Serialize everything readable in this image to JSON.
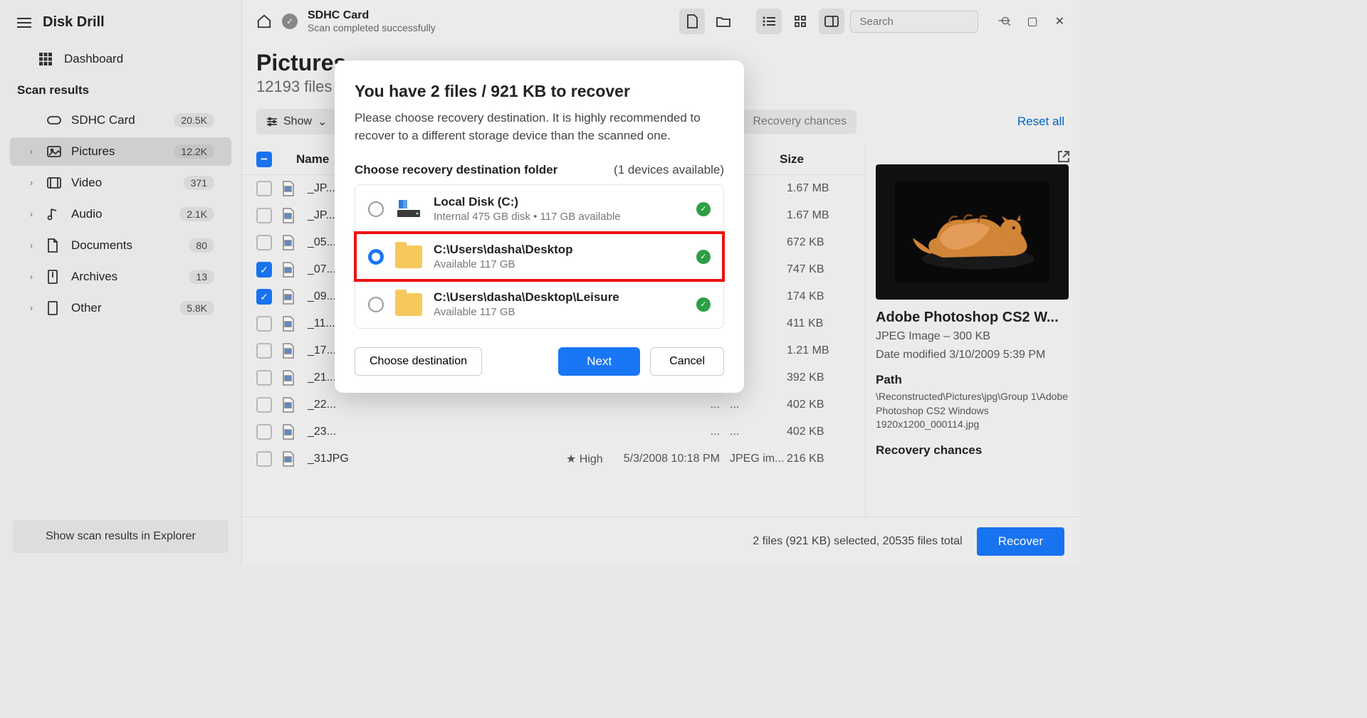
{
  "app": {
    "title": "Disk Drill"
  },
  "sidebar": {
    "dashboard": "Dashboard",
    "heading": "Scan results",
    "device": {
      "label": "SDHC Card",
      "count": "20.5K"
    },
    "nav": [
      {
        "label": "Pictures",
        "count": "12.2K"
      },
      {
        "label": "Video",
        "count": "371"
      },
      {
        "label": "Audio",
        "count": "2.1K"
      },
      {
        "label": "Documents",
        "count": "80"
      },
      {
        "label": "Archives",
        "count": "13"
      },
      {
        "label": "Other",
        "count": "5.8K"
      }
    ],
    "explorer_btn": "Show scan results in Explorer"
  },
  "topbar": {
    "title": "SDHC Card",
    "subtitle": "Scan completed successfully",
    "search_placeholder": "Search"
  },
  "page": {
    "title": "Pictures",
    "subtitle": "12193 files"
  },
  "filters": {
    "show": "Show",
    "chances": "Recovery chances",
    "reset": "Reset all"
  },
  "table": {
    "headers": {
      "name": "Name",
      "size": "Size"
    },
    "rows": [
      {
        "checked": false,
        "name": "_JP...",
        "size": "1.67 MB",
        "date": "...",
        "type": "..."
      },
      {
        "checked": false,
        "name": "_JP...",
        "size": "1.67 MB",
        "date": "...",
        "type": "..."
      },
      {
        "checked": false,
        "name": "_05...",
        "size": "672 KB",
        "date": "...",
        "type": "..."
      },
      {
        "checked": true,
        "name": "_07...",
        "size": "747 KB",
        "date": "...",
        "type": "..."
      },
      {
        "checked": true,
        "name": "_09...",
        "size": "174 KB",
        "date": "...",
        "type": "..."
      },
      {
        "checked": false,
        "name": "_11...",
        "size": "411 KB",
        "date": "...",
        "type": "..."
      },
      {
        "checked": false,
        "name": "_17...",
        "size": "1.21 MB",
        "date": "...",
        "type": "..."
      },
      {
        "checked": false,
        "name": "_21...",
        "size": "392 KB",
        "date": "...",
        "type": "..."
      },
      {
        "checked": false,
        "name": "_22...",
        "size": "402 KB",
        "date": "...",
        "type": "..."
      },
      {
        "checked": false,
        "name": "_23...",
        "size": "402 KB",
        "date": "...",
        "type": "..."
      },
      {
        "checked": false,
        "name": "_31JPG",
        "size": "216 KB",
        "date": "5/3/2008 10:18 PM",
        "type": "JPEG im...",
        "extra": "High"
      }
    ]
  },
  "preview": {
    "title": "Adobe Photoshop CS2 W...",
    "type": "JPEG Image – 300 KB",
    "date": "Date modified 3/10/2009 5:39 PM",
    "path_label": "Path",
    "path": "\\Reconstructed\\Pictures\\jpg\\Group 1\\Adobe Photoshop CS2 Windows 1920x1200_000114.jpg",
    "chances_label": "Recovery chances"
  },
  "footer": {
    "status": "2 files (921 KB) selected, 20535 files total",
    "recover": "Recover"
  },
  "modal": {
    "title": "You have 2 files / 921 KB to recover",
    "text": "Please choose recovery destination. It is highly recommended to recover to a different storage device than the scanned one.",
    "choose_label": "Choose recovery destination folder",
    "devices": "(1 devices available)",
    "destinations": [
      {
        "title": "Local Disk (C:)",
        "sub": "Internal 475 GB disk • 117 GB available",
        "type": "disk",
        "selected": false
      },
      {
        "title": "C:\\Users\\dasha\\Desktop",
        "sub": "Available 117 GB",
        "type": "folder",
        "selected": true
      },
      {
        "title": "C:\\Users\\dasha\\Desktop\\Leisure",
        "sub": "Available 117 GB",
        "type": "folder",
        "selected": false
      }
    ],
    "choose_btn": "Choose destination",
    "next": "Next",
    "cancel": "Cancel"
  }
}
